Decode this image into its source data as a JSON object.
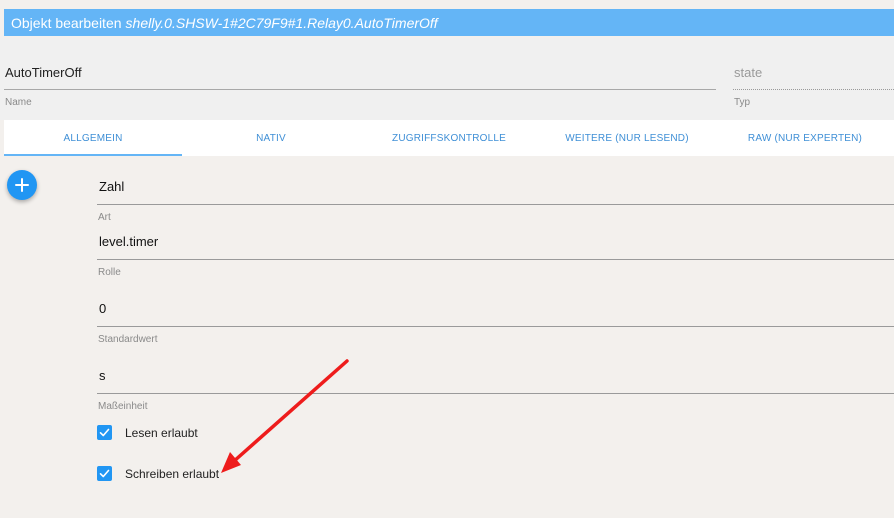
{
  "dialog": {
    "title_prefix": "Objekt bearbeiten",
    "object_path": "shelly.0.SHSW-1#2C79F9#1.Relay0.AutoTimerOff"
  },
  "header": {
    "name_value": "AutoTimerOff",
    "name_label": "Name",
    "type_placeholder": "state",
    "type_label": "Typ"
  },
  "tabs": [
    {
      "label": "ALLGEMEIN",
      "active": true
    },
    {
      "label": "NATIV",
      "active": false
    },
    {
      "label": "ZUGRIFFSKONTROLLE",
      "active": false
    },
    {
      "label": "WEITERE (NUR LESEND)",
      "active": false
    },
    {
      "label": "RAW (NUR EXPERTEN)",
      "active": false
    }
  ],
  "form": {
    "art": {
      "value": "Zahl",
      "label": "Art"
    },
    "rolle": {
      "value": "level.timer",
      "label": "Rolle"
    },
    "standardwert": {
      "value": "0",
      "label": "Standardwert"
    },
    "masseinheit": {
      "value": "s",
      "label": "Maßeinheit"
    }
  },
  "checkboxes": [
    {
      "label": "Lesen erlaubt",
      "checked": true
    },
    {
      "label": "Schreiben erlaubt",
      "checked": true
    }
  ],
  "colors": {
    "title_bg": "#64b5f6",
    "accent": "#2196f3",
    "annotation_arrow": "#ee1c1c"
  },
  "icons": {
    "add": "plus-icon",
    "check": "check-icon",
    "annotation": "arrow-icon"
  }
}
